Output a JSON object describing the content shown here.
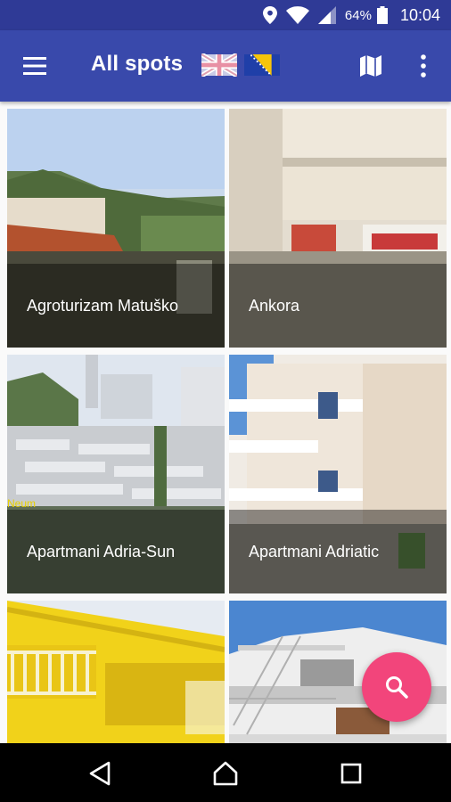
{
  "status_bar": {
    "battery": "64%",
    "time": "10:04",
    "icons": [
      "location-icon",
      "wifi-icon",
      "signal-icon",
      "battery-icon"
    ]
  },
  "app_bar": {
    "title": "All spots",
    "icons": [
      "menu-icon",
      "uk-flag-icon",
      "bosnia-flag-icon",
      "map-icon",
      "more-vert-icon"
    ],
    "color": "#3949ab"
  },
  "spots": [
    {
      "name": "Agroturizam Matuško"
    },
    {
      "name": "Ankora"
    },
    {
      "name": "Apartmani Adria-Sun",
      "watermark": "Neum"
    },
    {
      "name": "Apartmani Adriatic"
    },
    {
      "name": ""
    },
    {
      "name": ""
    }
  ],
  "fab": {
    "icon": "search-icon",
    "color": "#f2457b"
  },
  "nav_bar": {
    "icons": [
      "back-icon",
      "home-icon",
      "recents-icon"
    ]
  }
}
